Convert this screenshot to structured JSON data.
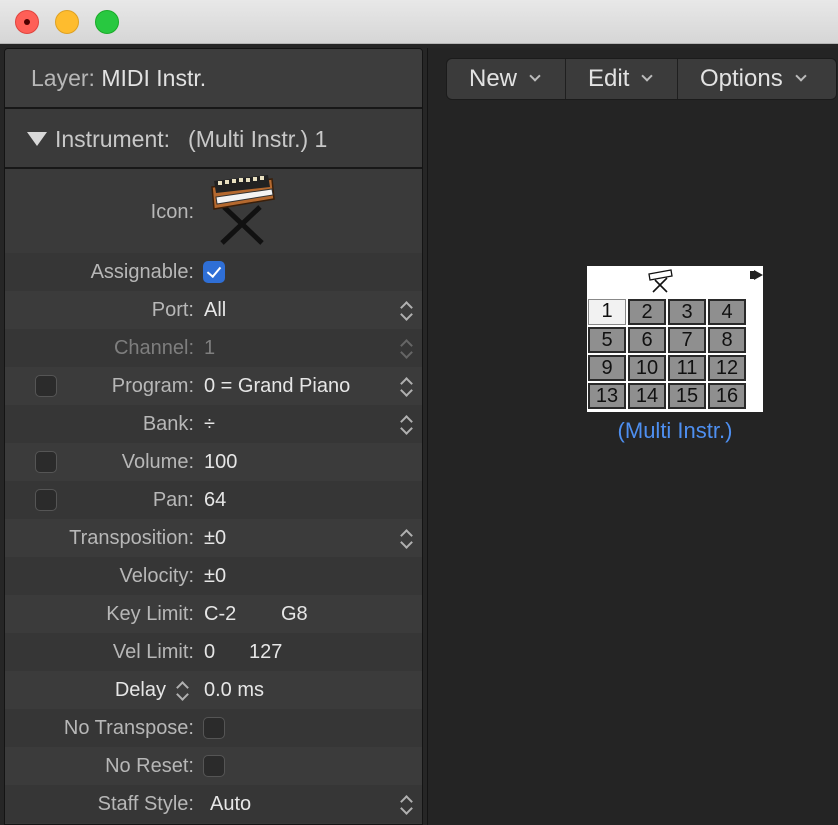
{
  "window": {
    "buttons": [
      "close",
      "minimize",
      "zoom"
    ]
  },
  "inspector": {
    "layer_label": "Layer:",
    "layer_value": "MIDI Instr.",
    "instrument_label": "Instrument:",
    "instrument_value": "(Multi Instr.) 1",
    "icon_label": "Icon:",
    "icon_name": "synthesizer-keyboard-icon",
    "assignable_label": "Assignable:",
    "assignable_checked": true,
    "port_label": "Port:",
    "port_value": "All",
    "channel_label": "Channel:",
    "channel_value": "1",
    "program_label": "Program:",
    "program_value": "0 = Grand Piano",
    "program_enabled": false,
    "bank_label": "Bank:",
    "bank_value": "÷",
    "volume_label": "Volume:",
    "volume_value": "100",
    "volume_enabled": false,
    "pan_label": "Pan:",
    "pan_value": "64",
    "pan_enabled": false,
    "transposition_label": "Transposition:",
    "transposition_value": "±0",
    "velocity_label": "Velocity:",
    "velocity_value": "±0",
    "key_limit_label": "Key Limit:",
    "key_limit_low": "C-2",
    "key_limit_high": "G8",
    "vel_limit_label": "Vel Limit:",
    "vel_limit_low": "0",
    "vel_limit_high": "127",
    "delay_label": "Delay",
    "delay_value": "0.0 ms",
    "no_transpose_label": "No Transpose:",
    "no_transpose_checked": false,
    "no_reset_label": "No Reset:",
    "no_reset_checked": false,
    "staff_style_label": "Staff Style:",
    "staff_style_value": "Auto"
  },
  "toolbar": {
    "new_label": "New",
    "edit_label": "Edit",
    "options_label": "Options"
  },
  "multi_instrument": {
    "name": "(Multi Instr.)",
    "channels": [
      "1",
      "2",
      "3",
      "4",
      "5",
      "6",
      "7",
      "8",
      "9",
      "10",
      "11",
      "12",
      "13",
      "14",
      "15",
      "16"
    ],
    "active_channel": "1"
  },
  "colors": {
    "accent": "#2f6fd6",
    "label_blue": "#4e8ff0"
  }
}
